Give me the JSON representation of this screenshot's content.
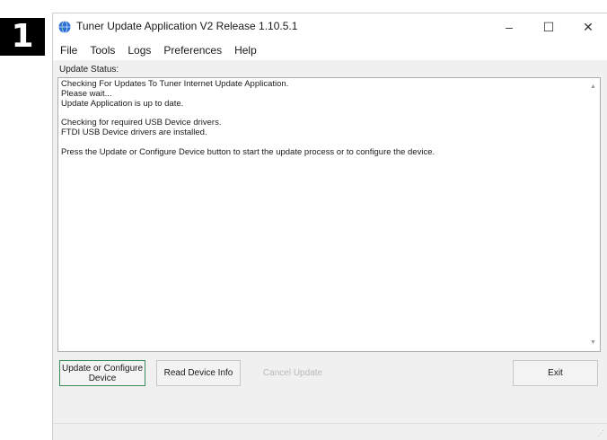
{
  "step_badge": "1",
  "window": {
    "title": "Tuner Update Application V2 Release 1.10.5.1",
    "controls": {
      "minimize": "–",
      "maximize": "☐",
      "close": "✕"
    }
  },
  "menu": [
    "File",
    "Tools",
    "Logs",
    "Preferences",
    "Help"
  ],
  "status": {
    "label": "Update Status:",
    "lines": [
      "Checking For Updates To Tuner Internet Update Application.",
      "Please wait...",
      "Update Application is up to date.",
      "",
      "Checking for required USB Device drivers.",
      "FTDI USB Device drivers are installed.",
      "",
      "Press the Update or Configure Device button to start the update process or to configure the device."
    ]
  },
  "buttons": {
    "update_line1": "Update or Configure",
    "update_line2": "Device",
    "read_info": "Read Device Info",
    "cancel": "Cancel Update",
    "exit": "Exit"
  },
  "icons": {
    "app": "globe-icon",
    "scroll_up": "scroll-up-arrow-icon",
    "scroll_down": "scroll-down-arrow-icon",
    "grip": "resize-grip-icon"
  },
  "colors": {
    "default_button_border": "#3c8c5a",
    "disabled_text": "#b9b9b9"
  }
}
